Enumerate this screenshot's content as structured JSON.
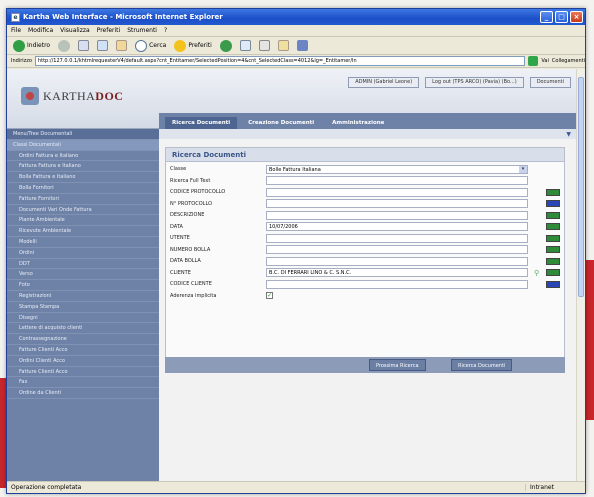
{
  "browser": {
    "title": "Kartha Web Interface - Microsoft Internet Explorer",
    "menu": [
      "File",
      "Modifica",
      "Visualizza",
      "Preferiti",
      "Strumenti",
      "?"
    ],
    "toolbar": {
      "back": "Indietro",
      "search": "Cerca",
      "favorites": "Preferiti"
    },
    "address_label": "Indirizzo",
    "address": "http://127.0.0.1/khtmlrequesterV4/default.aspx?cnt_Entitamer/SelectedPosition=4&cnt_SelectedClass=4012&lg=_Entitamer/In",
    "go_label": "Vai",
    "links_label": "Collegamenti",
    "status_left": "Operazione completata",
    "status_right": "Intranet"
  },
  "app": {
    "logo_text_a": "KARTHA",
    "logo_text_b": "DOC",
    "header_buttons": [
      "ADMIN (Gabriel Leone)",
      "Log out (TPS ARCO) (Pavia) (Bo...)",
      "Documenti"
    ],
    "nav_tabs": [
      "Ricerca Documenti",
      "Creazione Documenti",
      "Amministrazione"
    ]
  },
  "sidebar": {
    "items": [
      {
        "label": "Menu/Tree Documentali",
        "kind": "head"
      },
      {
        "label": "Classi Documentali",
        "kind": "selected"
      },
      {
        "label": "Ordini Fattura e Italiano",
        "kind": "item"
      },
      {
        "label": "Fattura Fattura e Italiano",
        "kind": "item"
      },
      {
        "label": "Bolla Fattura e Italiano",
        "kind": "item"
      },
      {
        "label": "Bolla Fornitori",
        "kind": "item"
      },
      {
        "label": "Fatture Fornitori",
        "kind": "item"
      },
      {
        "label": "Documenti Vari Onde Fattura",
        "kind": "item"
      },
      {
        "label": "Piante Ambientale",
        "kind": "item"
      },
      {
        "label": "Ricevute Ambientale",
        "kind": "item"
      },
      {
        "label": "Modelli",
        "kind": "item"
      },
      {
        "label": "Ordini",
        "kind": "item"
      },
      {
        "label": "DDT",
        "kind": "item"
      },
      {
        "label": "Verso",
        "kind": "item"
      },
      {
        "label": "Foto",
        "kind": "item"
      },
      {
        "label": "Registrazioni",
        "kind": "item"
      },
      {
        "label": "Stampa Stampa",
        "kind": "item"
      },
      {
        "label": "Disegni",
        "kind": "item"
      },
      {
        "label": "Lettere di acquisto clienti",
        "kind": "item"
      },
      {
        "label": "Contrassegnazione",
        "kind": "item"
      },
      {
        "label": "Fatture Clienti Acco",
        "kind": "item"
      },
      {
        "label": "Ordini Clienti Acco",
        "kind": "item"
      },
      {
        "label": "Fatture Clienti Acco",
        "kind": "item"
      },
      {
        "label": "Fax",
        "kind": "item"
      },
      {
        "label": "Ordine da Clienti",
        "kind": "item"
      }
    ]
  },
  "form": {
    "title": "Ricerca Documenti",
    "rows": [
      {
        "label": "Classe",
        "type": "select",
        "value": "Bolle Fattura Italiana",
        "button": ""
      },
      {
        "label": "Ricerca Full Text",
        "type": "text",
        "value": "",
        "button": ""
      },
      {
        "label": "CODICE PROTOCOLLO",
        "type": "text",
        "value": "",
        "button": "green"
      },
      {
        "label": "N° PROTOCOLLO",
        "type": "text",
        "value": "",
        "button": "blue"
      },
      {
        "label": "DESCRIZIONE",
        "type": "text",
        "value": "",
        "button": "green"
      },
      {
        "label": "DATA",
        "type": "text",
        "value": "10/07/2006",
        "button": "green"
      },
      {
        "label": "UTENTE",
        "type": "text",
        "value": "",
        "button": "green"
      },
      {
        "label": "NUMERO BOLLA",
        "type": "text",
        "value": "",
        "button": "green"
      },
      {
        "label": "DATA BOLLA",
        "type": "text",
        "value": "",
        "button": "green"
      },
      {
        "label": "CLIENTE",
        "type": "text",
        "value": "B.C. DI FERRARI LINO & C. S.N.C.",
        "button": "green"
      },
      {
        "label": "CODICE CLIENTE",
        "type": "text",
        "value": "",
        "button": "blue"
      },
      {
        "label": "Aderenza implicita",
        "type": "checkbox",
        "value": "✓",
        "button": ""
      }
    ],
    "actions": [
      "Prossima Ricerca",
      "Ricerca Documenti"
    ]
  }
}
